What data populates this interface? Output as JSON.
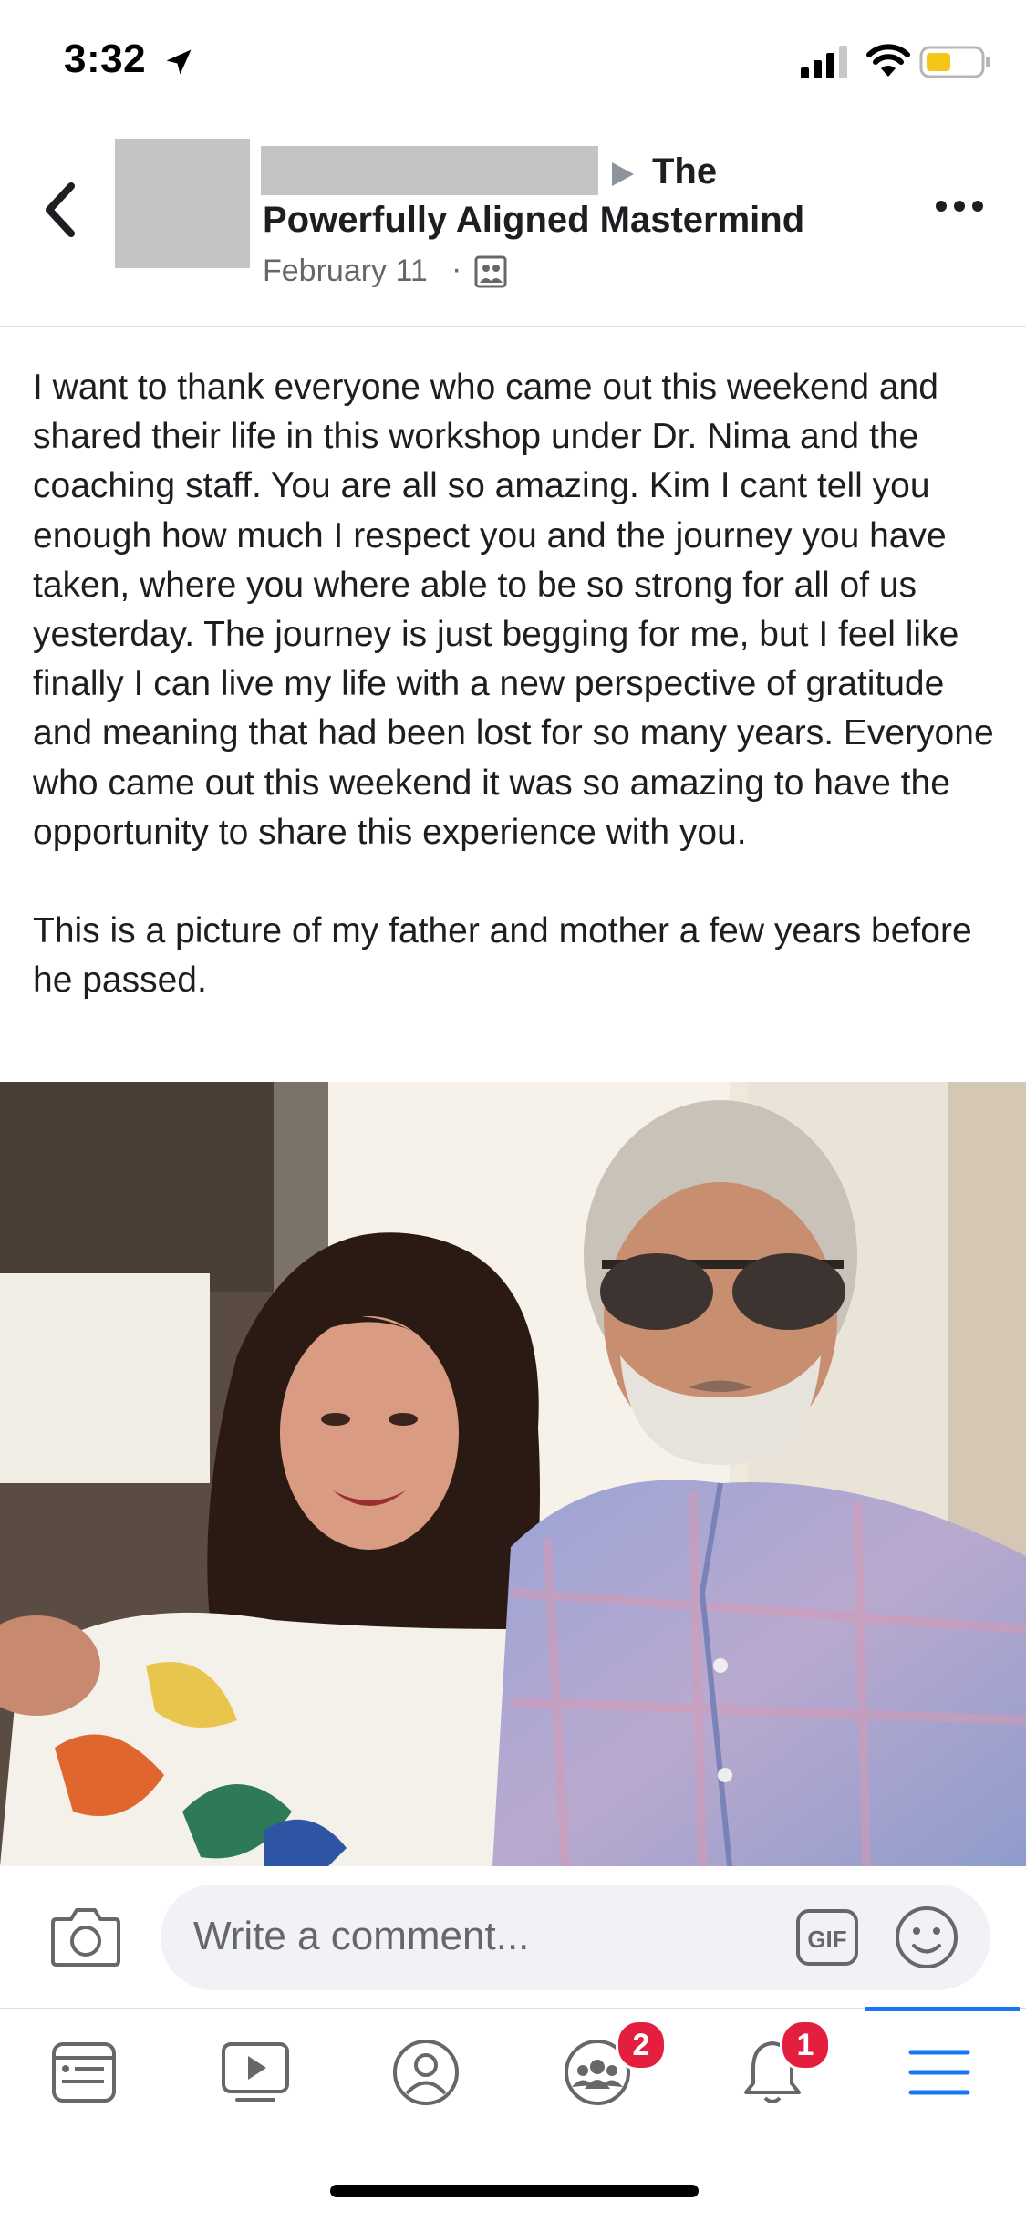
{
  "status_bar": {
    "time": "3:32",
    "battery_color": "#f5c518"
  },
  "post": {
    "group_prefix": "The",
    "group_name": "Powerfully Aligned Mastermind",
    "date": "February 11",
    "separator": "·",
    "paragraphs": [
      "I want to thank everyone who came out this weekend and shared their life in this workshop under Dr. Nima and the coaching staff. You are all so amazing. Kim I cant tell you enough how much I respect you and the journey you have taken, where you where able to be so strong for all of us yesterday. The journey is just begging for me, but I feel like finally I can live my life with a new perspective of gratitude and meaning that had been lost for so many years. Everyone who came out this weekend it was so amazing to have the opportunity to share this experience with you.",
      "This is a picture of my father and mother a few years before he passed."
    ]
  },
  "comment_bar": {
    "placeholder": "Write a comment...",
    "gif_label": "GIF"
  },
  "nav": {
    "items": [
      {
        "icon": "news-feed-icon"
      },
      {
        "icon": "watch-icon"
      },
      {
        "icon": "profile-icon"
      },
      {
        "icon": "groups-icon",
        "badge": "2"
      },
      {
        "icon": "notifications-icon",
        "badge": "1"
      },
      {
        "icon": "menu-icon",
        "active": true
      }
    ],
    "accent_color": "#1877f2",
    "badge_color": "#e41e3f"
  }
}
